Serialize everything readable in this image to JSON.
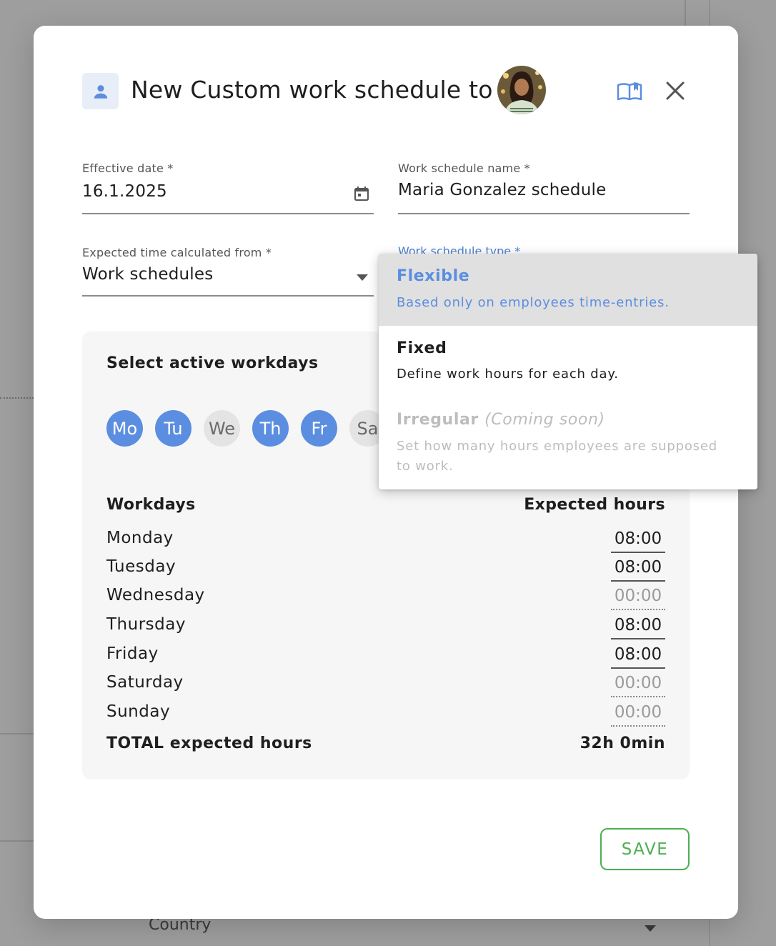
{
  "background": {
    "country_label": "Country"
  },
  "header": {
    "title": "New Custom work schedule to",
    "icons": {
      "user": "person-icon",
      "guide": "book-icon",
      "close": "close-icon"
    }
  },
  "form": {
    "effective_date": {
      "label": "Effective date *",
      "value": "16.1.2025"
    },
    "schedule_name": {
      "label": "Work schedule name *",
      "value": "Maria Gonzalez schedule"
    },
    "expected_from": {
      "label": "Expected time calculated from *",
      "value": "Work schedules"
    },
    "schedule_type": {
      "label": "Work schedule type *"
    }
  },
  "workdays": {
    "title": "Select active workdays",
    "chips": [
      {
        "label": "Mo",
        "active": true
      },
      {
        "label": "Tu",
        "active": true
      },
      {
        "label": "We",
        "active": false
      },
      {
        "label": "Th",
        "active": true
      },
      {
        "label": "Fr",
        "active": true
      },
      {
        "label": "Sa",
        "active": false
      }
    ],
    "col_workdays": "Workdays",
    "col_hours": "Expected hours",
    "rows": [
      {
        "day": "Monday",
        "hours": "08:00",
        "active": true
      },
      {
        "day": "Tuesday",
        "hours": "08:00",
        "active": true
      },
      {
        "day": "Wednesday",
        "hours": "00:00",
        "active": false
      },
      {
        "day": "Thursday",
        "hours": "08:00",
        "active": true
      },
      {
        "day": "Friday",
        "hours": "08:00",
        "active": true
      },
      {
        "day": "Saturday",
        "hours": "00:00",
        "active": false
      },
      {
        "day": "Sunday",
        "hours": "00:00",
        "active": false
      }
    ],
    "total_label": "TOTAL expected hours",
    "total_value": "32h 0min"
  },
  "actions": {
    "save": "SAVE"
  },
  "menu": {
    "items": [
      {
        "title": "Flexible",
        "note": "",
        "desc": "Based only on employees time-entries.",
        "state": "selected"
      },
      {
        "title": "Fixed",
        "note": "",
        "desc": "Define work hours for each day.",
        "state": "normal"
      },
      {
        "title": "Irregular",
        "note": "(Coming soon)",
        "desc": "Set how many hours employees are supposed to work.",
        "state": "disabled"
      }
    ]
  },
  "colors": {
    "accent": "#5b8ee0",
    "save": "#4caf50",
    "disabled": "#bdbdbd"
  }
}
